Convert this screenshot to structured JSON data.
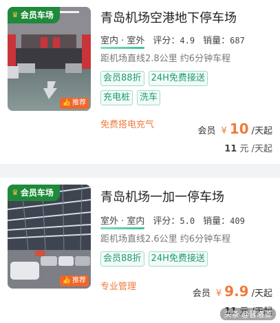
{
  "colors": {
    "accent": "#f07a3c",
    "tag_green": "#1b9b6e",
    "member_green": "#1e8a3a"
  },
  "listings": [
    {
      "member_badge": "会员车场",
      "recommend_badge": "推荐",
      "title": "青岛机场空港地下停车场",
      "location": "室内 · 室外",
      "rating_label": "评分：",
      "rating": "4.9",
      "sales_label": "销量：",
      "sales": "687",
      "distance": "距机场直线2.8公里 约6分钟车程",
      "tags": [
        "会员88折",
        "24H免费接送",
        "充电桩",
        "洗车"
      ],
      "promo": "免费搭电充气",
      "member_label": "会员",
      "currency": "¥",
      "member_price": "10",
      "price_unit": "/天起",
      "original_price": "11",
      "original_unit": "元 /天起"
    },
    {
      "member_badge": "会员车场",
      "recommend_badge": "推荐",
      "title": "青岛机场一加一停车场",
      "location": "室外 · 室内",
      "rating_label": "评分：",
      "rating": "5.0",
      "sales_label": "销量：",
      "sales": "409",
      "distance": "距机场直线2.6公里 约6分钟车程",
      "tags": [
        "会员88折",
        "24H免费接送"
      ],
      "promo": "专业管理",
      "member_label": "会员",
      "currency": "¥",
      "member_price": "9.9",
      "price_unit": "/天起",
      "original_price": "11",
      "original_unit": "元 /天起"
    }
  ],
  "watermark": "头条 @晋洛亚"
}
